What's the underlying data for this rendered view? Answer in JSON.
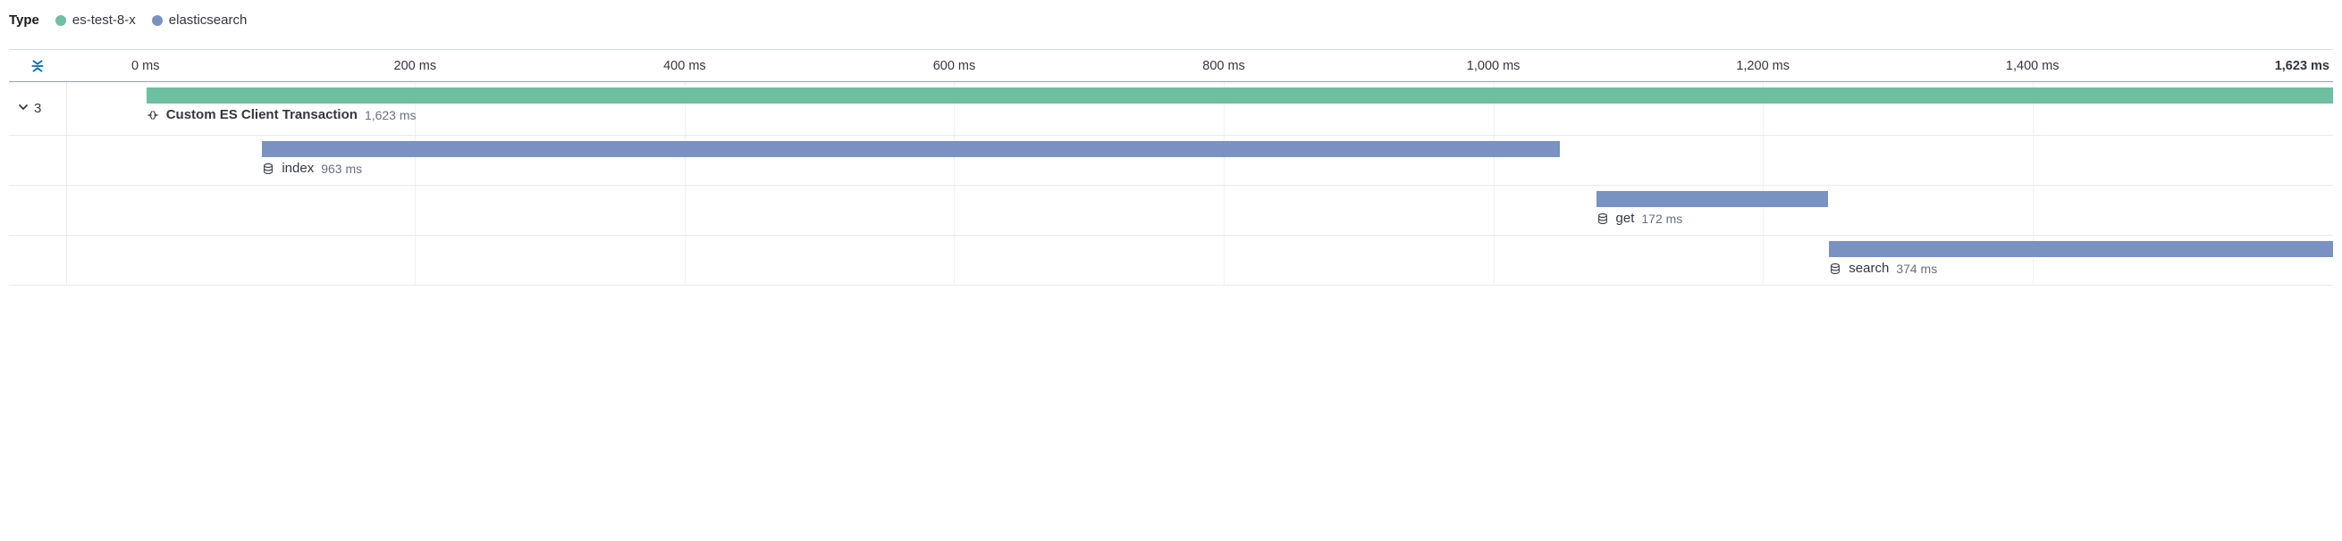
{
  "legend": {
    "label": "Type",
    "items": [
      {
        "color": "#6dbfa0",
        "label": "es-test-8-x"
      },
      {
        "color": "#7992c1",
        "label": "elasticsearch"
      }
    ]
  },
  "chart_data": {
    "type": "bar",
    "title": "",
    "xlabel": "",
    "ylabel": "",
    "x_range_ms": [
      0,
      1623
    ],
    "ticks_ms": [
      0,
      200,
      400,
      600,
      800,
      1000,
      1200,
      1400,
      1623
    ],
    "series": [
      {
        "name": "Custom ES Client Transaction",
        "type": "es-test-8-x",
        "color": "#6dbfa0",
        "start_ms": 0,
        "duration_ms": 1623,
        "child_count": 3,
        "icon": "apm"
      },
      {
        "name": "index",
        "type": "elasticsearch",
        "color": "#7992c1",
        "start_ms": 86,
        "duration_ms": 963,
        "icon": "database"
      },
      {
        "name": "get",
        "type": "elasticsearch",
        "color": "#7992c1",
        "start_ms": 1076,
        "duration_ms": 172,
        "icon": "database"
      },
      {
        "name": "search",
        "type": "elasticsearch",
        "color": "#7992c1",
        "start_ms": 1249,
        "duration_ms": 374,
        "icon": "database"
      }
    ]
  },
  "tick_labels": [
    "0 ms",
    "200 ms",
    "400 ms",
    "600 ms",
    "800 ms",
    "1,000 ms",
    "1,200 ms",
    "1,400 ms",
    "1,623 ms"
  ],
  "row_labels": {
    "transaction_name": "Custom ES Client Transaction",
    "transaction_dur": "1,623 ms",
    "transaction_children": "3",
    "index_name": "index",
    "index_dur": "963 ms",
    "get_name": "get",
    "get_dur": "172 ms",
    "search_name": "search",
    "search_dur": "374 ms"
  }
}
